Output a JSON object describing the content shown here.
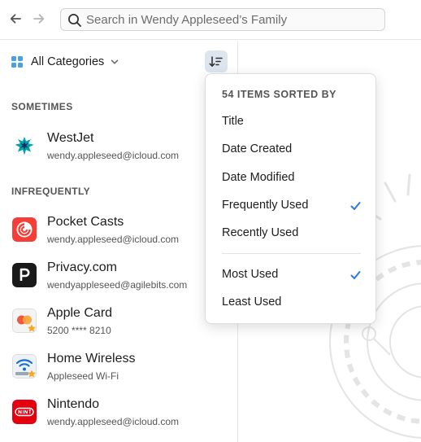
{
  "search": {
    "placeholder": "Search in Wendy Appleseed’s Family"
  },
  "category": {
    "label": "All Categories"
  },
  "sections": [
    {
      "header": "SOMETIMES",
      "items": [
        {
          "title": "WestJet",
          "subtitle": "wendy.appleseed@icloud.com",
          "icon": "westjet-logo-icon"
        }
      ]
    },
    {
      "header": "INFREQUENTLY",
      "items": [
        {
          "title": "Pocket Casts",
          "subtitle": "wendy.appleseed@icloud.com",
          "icon": "pocket-casts-logo-icon"
        },
        {
          "title": "Privacy.com",
          "subtitle": "wendyappleseed@agilebits.com",
          "icon": "privacy-logo-icon"
        },
        {
          "title": "Apple Card",
          "subtitle": "5200 **** 8210",
          "icon": "credit-card-icon"
        },
        {
          "title": "Home Wireless",
          "subtitle": "Appleseed Wi-Fi",
          "icon": "wireless-router-icon"
        },
        {
          "title": "Nintendo",
          "subtitle": "wendy.appleseed@icloud.com",
          "icon": "nintendo-logo-icon"
        }
      ]
    }
  ],
  "sort_menu": {
    "header": "54 ITEMS SORTED BY",
    "sort_by": [
      {
        "label": "Title",
        "checked": false
      },
      {
        "label": "Date Created",
        "checked": false
      },
      {
        "label": "Date Modified",
        "checked": false
      },
      {
        "label": "Frequently Used",
        "checked": true
      },
      {
        "label": "Recently Used",
        "checked": false
      }
    ],
    "order": [
      {
        "label": "Most Used",
        "checked": true
      },
      {
        "label": "Least Used",
        "checked": false
      }
    ]
  },
  "colors": {
    "accent": "#1a73e8",
    "checkmark": "#2c7be5",
    "favorite_star": "#f5a623"
  }
}
